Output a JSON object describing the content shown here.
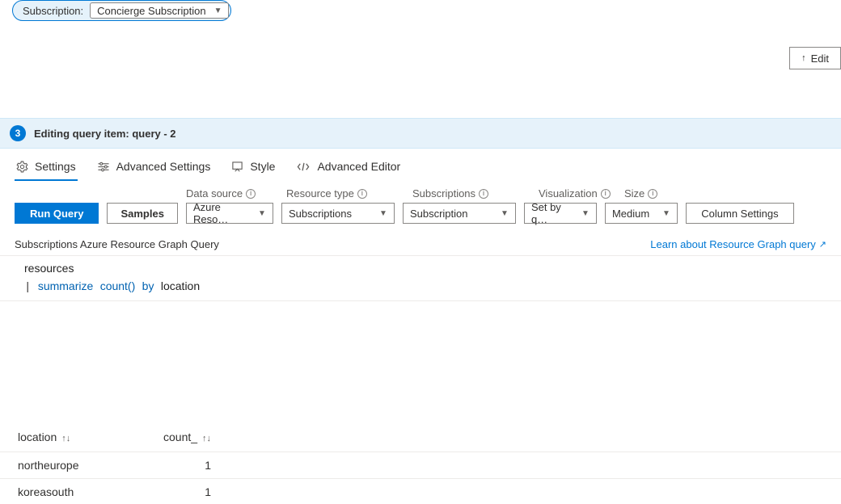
{
  "subscription": {
    "label": "Subscription:",
    "selected": "Concierge Subscription"
  },
  "edit_button": "Edit",
  "banner": {
    "step": "3",
    "prefix": "Editing query item: ",
    "name": "query",
    "suffix": " - 2"
  },
  "tabs": {
    "settings": "Settings",
    "advanced_settings": "Advanced Settings",
    "style": "Style",
    "advanced_editor": "Advanced Editor"
  },
  "controls": {
    "run_query": "Run Query",
    "samples": "Samples",
    "column_settings": "Column Settings",
    "labels": {
      "data_source": "Data source",
      "resource_type": "Resource type",
      "subscriptions": "Subscriptions",
      "visualization": "Visualization",
      "size": "Size"
    },
    "values": {
      "data_source": "Azure Reso…",
      "resource_type": "Subscriptions",
      "subscriptions": "Subscription",
      "visualization": "Set by q…",
      "size": "Medium"
    }
  },
  "subheader": {
    "text": "Subscriptions Azure Resource Graph Query",
    "link": "Learn about Resource Graph query"
  },
  "query": {
    "line1": "resources",
    "kw_summarize": "summarize",
    "fn_count": "count()",
    "kw_by": "by",
    "id_location": "location"
  },
  "results": {
    "headers": {
      "location": "location",
      "count": "count_"
    },
    "rows": [
      {
        "location": "northeurope",
        "count": "1"
      },
      {
        "location": "koreasouth",
        "count": "1"
      }
    ]
  }
}
